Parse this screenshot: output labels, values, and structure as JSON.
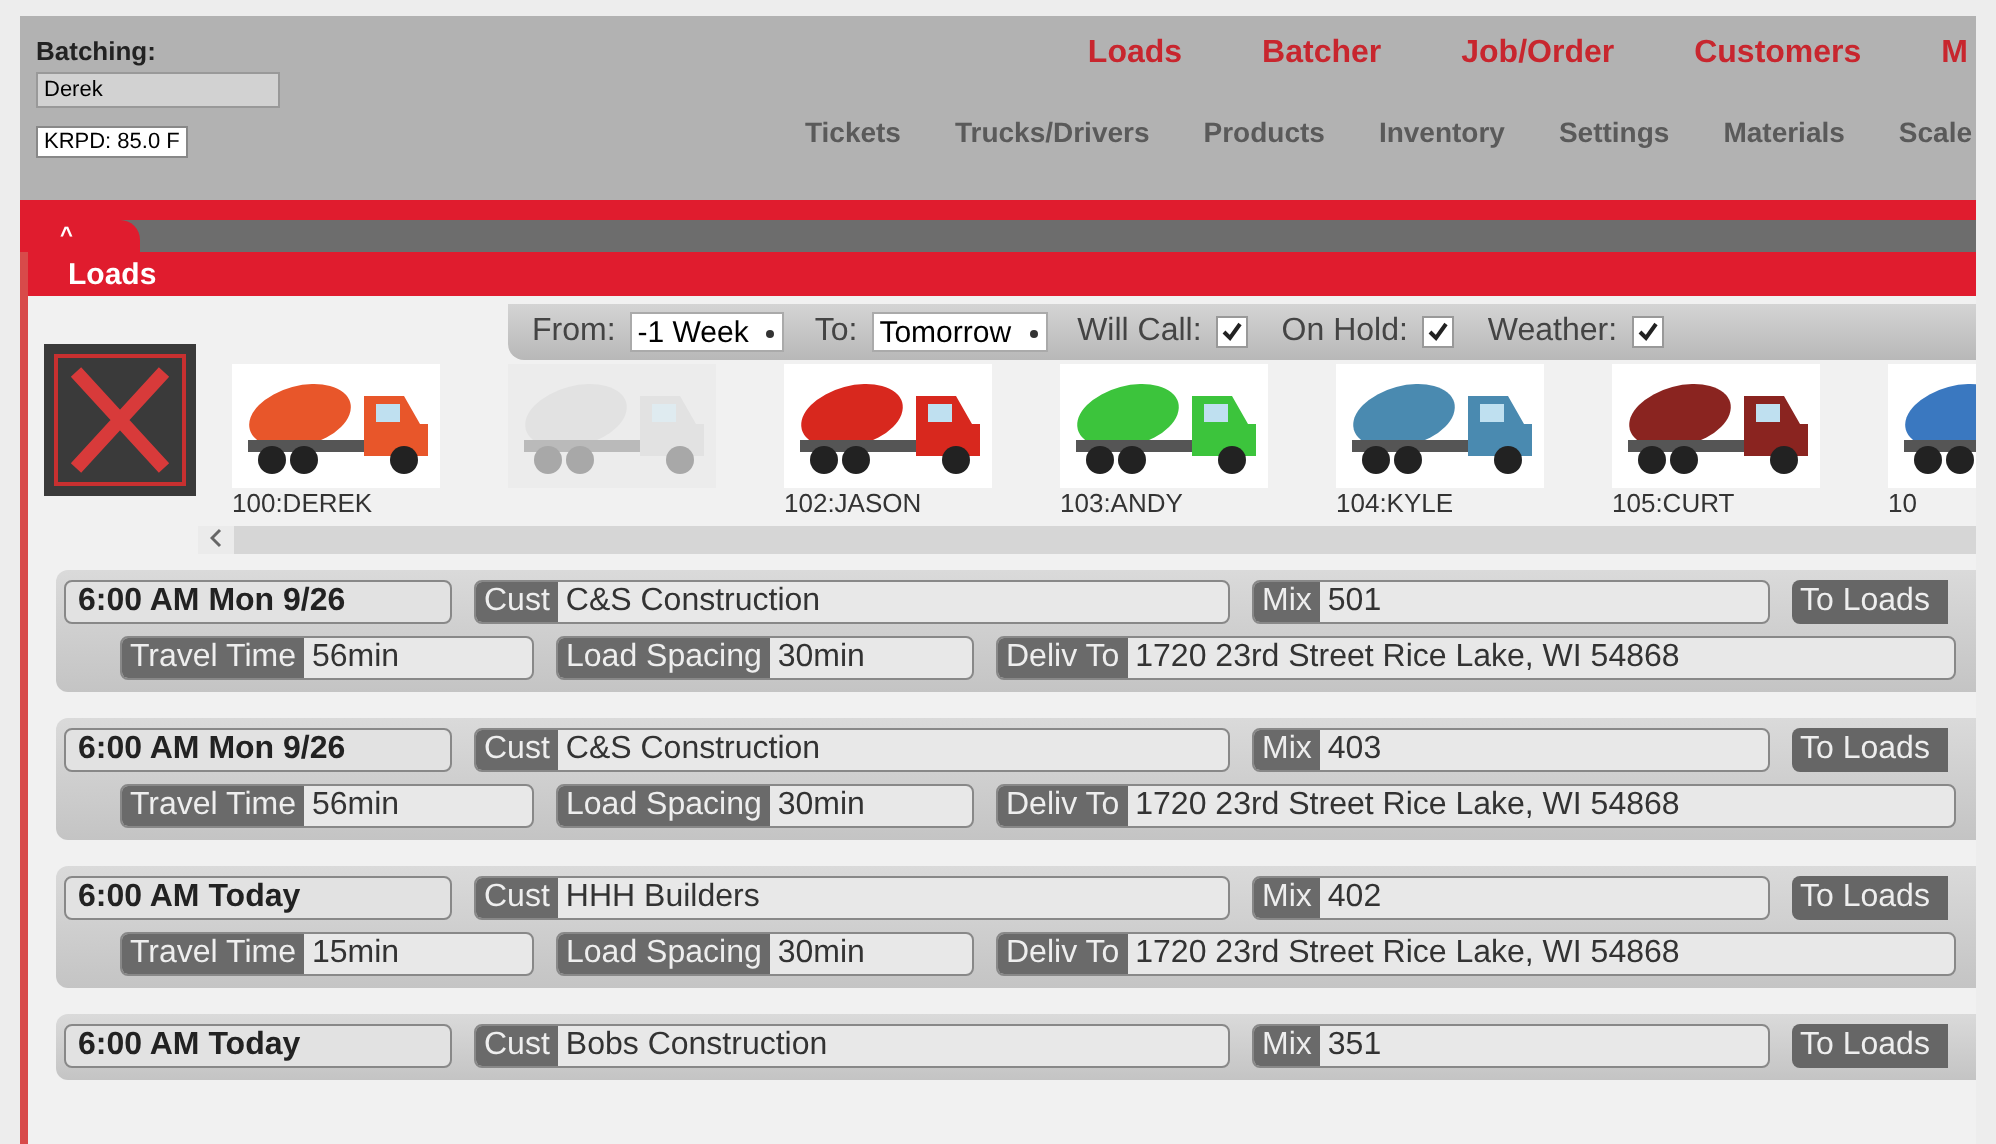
{
  "header": {
    "batching_label": "Batching:",
    "batcher": {
      "value": "Derek"
    },
    "weather_badge": "KRPD: 85.0 F"
  },
  "main_nav": [
    {
      "label": "Loads"
    },
    {
      "label": "Batcher"
    },
    {
      "label": "Job/Order"
    },
    {
      "label": "Customers"
    },
    {
      "label": "M"
    }
  ],
  "sub_nav": [
    {
      "label": "Tickets"
    },
    {
      "label": "Trucks/Drivers"
    },
    {
      "label": "Products"
    },
    {
      "label": "Inventory"
    },
    {
      "label": "Settings"
    },
    {
      "label": "Materials"
    },
    {
      "label": "Scale"
    }
  ],
  "collapse_tab": "^",
  "panel": {
    "title": "Loads"
  },
  "filters": {
    "from_label": "From:",
    "from_value": "-1 Week",
    "to_label": "To:",
    "to_value": "Tomorrow",
    "toggles": [
      {
        "label": "Will Call:",
        "checked": true
      },
      {
        "label": "On Hold:",
        "checked": true
      },
      {
        "label": "Weather:",
        "checked": true
      }
    ]
  },
  "trucks": [
    {
      "label": "100:DEREK",
      "color": "#e8562a",
      "disabled": false
    },
    {
      "color": "#c8c8c8",
      "disabled": true
    },
    {
      "label": "102:JASON",
      "color": "#d8281e",
      "disabled": false
    },
    {
      "label": "103:ANDY",
      "color": "#3cc43c",
      "disabled": false
    },
    {
      "label": "104:KYLE",
      "color": "#4a8ab0",
      "disabled": false
    },
    {
      "label": "105:CURT",
      "color": "#8a2420",
      "disabled": false
    },
    {
      "label": "10",
      "color": "#3a78c0",
      "disabled": false
    }
  ],
  "loads": [
    {
      "time": "6:00 AM Mon 9/26",
      "cust_label": "Cust",
      "customer": "C&S Construction",
      "mix_label": "Mix",
      "mix": "501",
      "action": "To Loads",
      "travel_label": "Travel Time",
      "travel": "56min",
      "spacing_label": "Load Spacing",
      "spacing": "30min",
      "deliv_label": "Deliv To",
      "deliv": "1720 23rd Street Rice Lake, WI 54868"
    },
    {
      "time": "6:00 AM Mon 9/26",
      "cust_label": "Cust",
      "customer": "C&S Construction",
      "mix_label": "Mix",
      "mix": "403",
      "action": "To Loads",
      "travel_label": "Travel Time",
      "travel": "56min",
      "spacing_label": "Load Spacing",
      "spacing": "30min",
      "deliv_label": "Deliv To",
      "deliv": "1720 23rd Street Rice Lake, WI 54868"
    },
    {
      "time": "6:00 AM Today",
      "cust_label": "Cust",
      "customer": "HHH Builders",
      "mix_label": "Mix",
      "mix": "402",
      "action": "To Loads",
      "travel_label": "Travel Time",
      "travel": "15min",
      "spacing_label": "Load Spacing",
      "spacing": "30min",
      "deliv_label": "Deliv To",
      "deliv": "1720 23rd Street Rice Lake, WI 54868"
    },
    {
      "time": "6:00 AM Today",
      "cust_label": "Cust",
      "customer": "Bobs Construction",
      "mix_label": "Mix",
      "mix": "351",
      "action": "To Loads"
    }
  ]
}
